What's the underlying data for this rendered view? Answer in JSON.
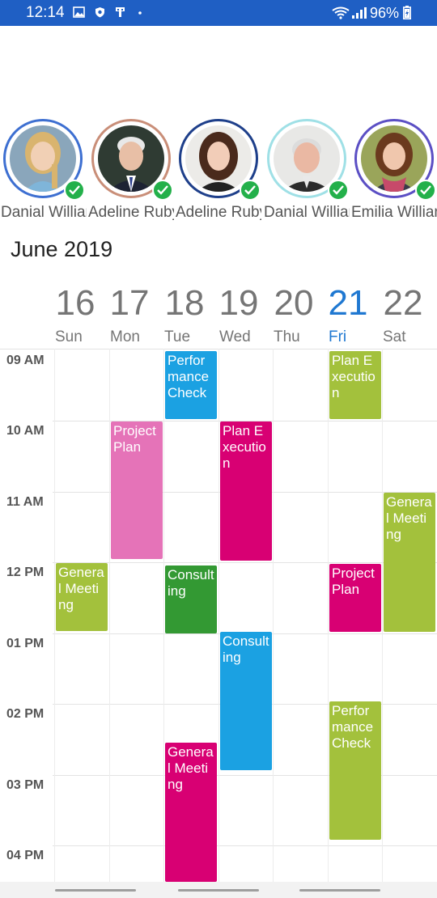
{
  "status_bar": {
    "time": "12:14",
    "battery": "96%"
  },
  "resources": [
    {
      "name": "Danial William",
      "ring_color": "#3d6fd1",
      "icon": "avatar-woman-blonde"
    },
    {
      "name": "Adeline Ruby",
      "ring_color": "#c98e78",
      "icon": "avatar-man-suit"
    },
    {
      "name": "Adeline Ruby",
      "ring_color": "#1e3f8a",
      "icon": "avatar-woman-dark-hair"
    },
    {
      "name": "Danial William",
      "ring_color": "#9fe0e6",
      "icon": "avatar-old-man"
    },
    {
      "name": "Emilia William",
      "ring_color": "#5b4fc4",
      "icon": "avatar-woman-scarf"
    }
  ],
  "calendar": {
    "month": "June 2019",
    "days": [
      {
        "num": "16",
        "name": "Sun"
      },
      {
        "num": "17",
        "name": "Mon"
      },
      {
        "num": "18",
        "name": "Tue"
      },
      {
        "num": "19",
        "name": "Wed"
      },
      {
        "num": "20",
        "name": "Thu"
      },
      {
        "num": "21",
        "name": "Fri",
        "today": true
      },
      {
        "num": "22",
        "name": "Sat"
      }
    ],
    "times": [
      "09 AM",
      "10 AM",
      "11 AM",
      "12 PM",
      "01 PM",
      "02 PM",
      "03 PM",
      "04 PM"
    ],
    "appointments": [
      {
        "subject": "Performance Check",
        "day": "Tue",
        "start": "09:00",
        "end": "10:00",
        "color": "#1ba1e2"
      },
      {
        "subject": "Plan Execution",
        "day": "Fri",
        "start": "09:00",
        "end": "10:00",
        "color": "#a3c13c"
      },
      {
        "subject": "Project Plan",
        "day": "Mon",
        "start": "10:00",
        "end": "12:00",
        "color": "#e573b8"
      },
      {
        "subject": "Plan Execution",
        "day": "Wed",
        "start": "10:00",
        "end": "12:00",
        "color": "#d80073"
      },
      {
        "subject": "General Meeting",
        "day": "Sat",
        "start": "11:00",
        "end": "13:00",
        "color": "#a3c13c"
      },
      {
        "subject": "General Meeting",
        "day": "Sun",
        "start": "12:00",
        "end": "13:00",
        "color": "#a3c13c"
      },
      {
        "subject": "Consulting",
        "day": "Tue",
        "start": "12:00",
        "end": "13:00",
        "color": "#339933"
      },
      {
        "subject": "Project Plan",
        "day": "Fri",
        "start": "12:00",
        "end": "13:00",
        "color": "#d80073"
      },
      {
        "subject": "Consulting",
        "day": "Wed",
        "start": "13:00",
        "end": "15:00",
        "color": "#1ba1e2"
      },
      {
        "subject": "Performance Check",
        "day": "Fri",
        "start": "14:00",
        "end": "16:00",
        "color": "#a3c13c"
      },
      {
        "subject": "General Meeting",
        "day": "Tue",
        "start": "15:00",
        "end": "17:00",
        "color": "#d80073"
      }
    ]
  }
}
